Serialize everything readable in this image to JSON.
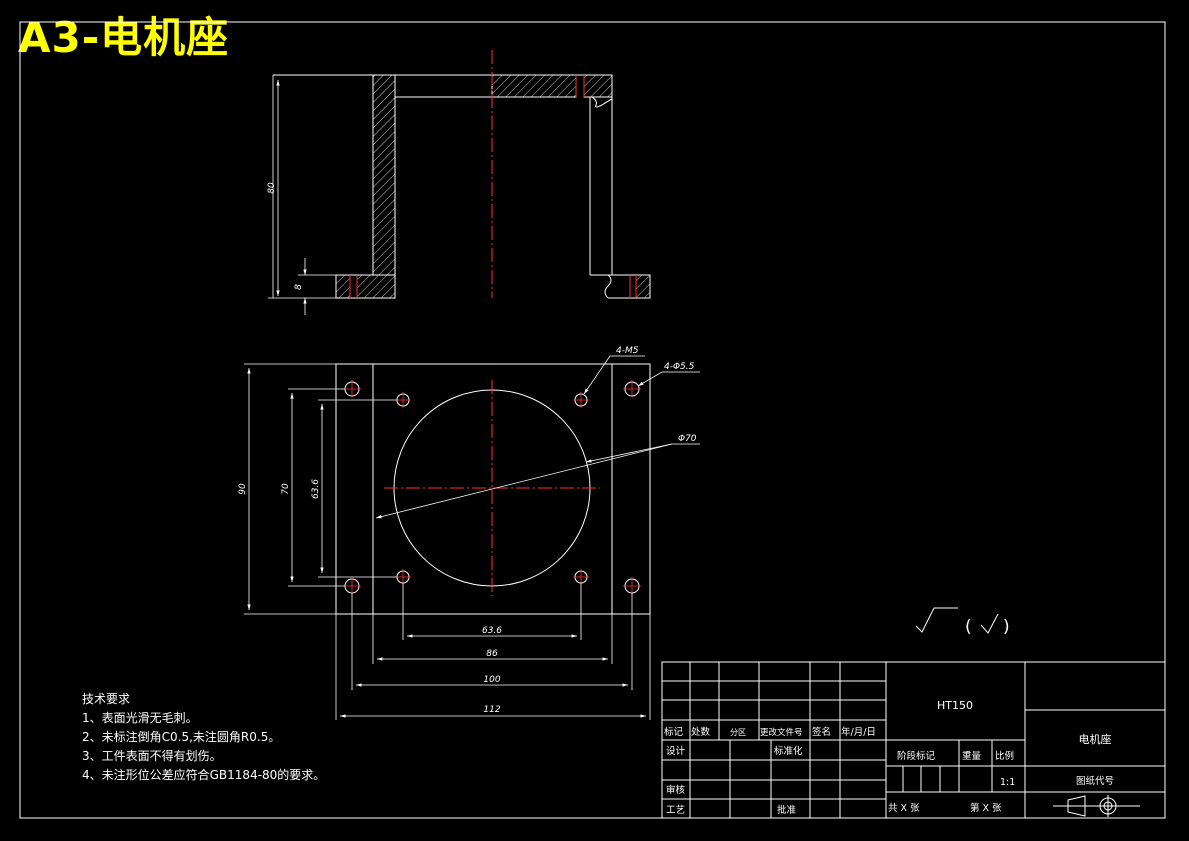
{
  "sheet_title": "A3-电机座",
  "section_dimensions": {
    "height": "80",
    "base_thickness": "8"
  },
  "plan_dimensions": {
    "holes_m5": "4-M5",
    "holes_clearance": "4-Φ5.5",
    "circle": "Φ70",
    "outer_height": "90",
    "hole_spacing_vertical": "70",
    "m5_spacing_vertical": "63.6",
    "m5_spacing_horizontal": "63.6",
    "inner_width": "86",
    "hole_spacing_horizontal": "100",
    "overall_width": "112"
  },
  "surface_finish": {
    "parenthesis_open": "(",
    "parenthesis_close": ")"
  },
  "tech_requirements": {
    "heading": "技术要求",
    "items": [
      "1、表面光滑无毛刺。",
      "2、未标注倒角C0.5,未注圆角R0.5。",
      "3、工件表面不得有划伤。",
      "4、未注形位公差应符合GB1184-80的要求。"
    ]
  },
  "title_block": {
    "material": "HT150",
    "part_name": "电机座",
    "drawing_number_label": "图纸代号",
    "scale_label": "比例",
    "scale_value": "1:1",
    "weight_label": "重量",
    "stage_label": "阶段标记",
    "sheets_total": "共 X 张",
    "sheet_index": "第 X 张",
    "rev_headers": [
      "标记",
      "处数",
      "分区",
      "更改文件号",
      "签名",
      "年/月/日"
    ],
    "design_label": "设计",
    "standardization_label": "标准化",
    "review_label": "审核",
    "process_label": "工艺",
    "approve_label": "批准"
  }
}
